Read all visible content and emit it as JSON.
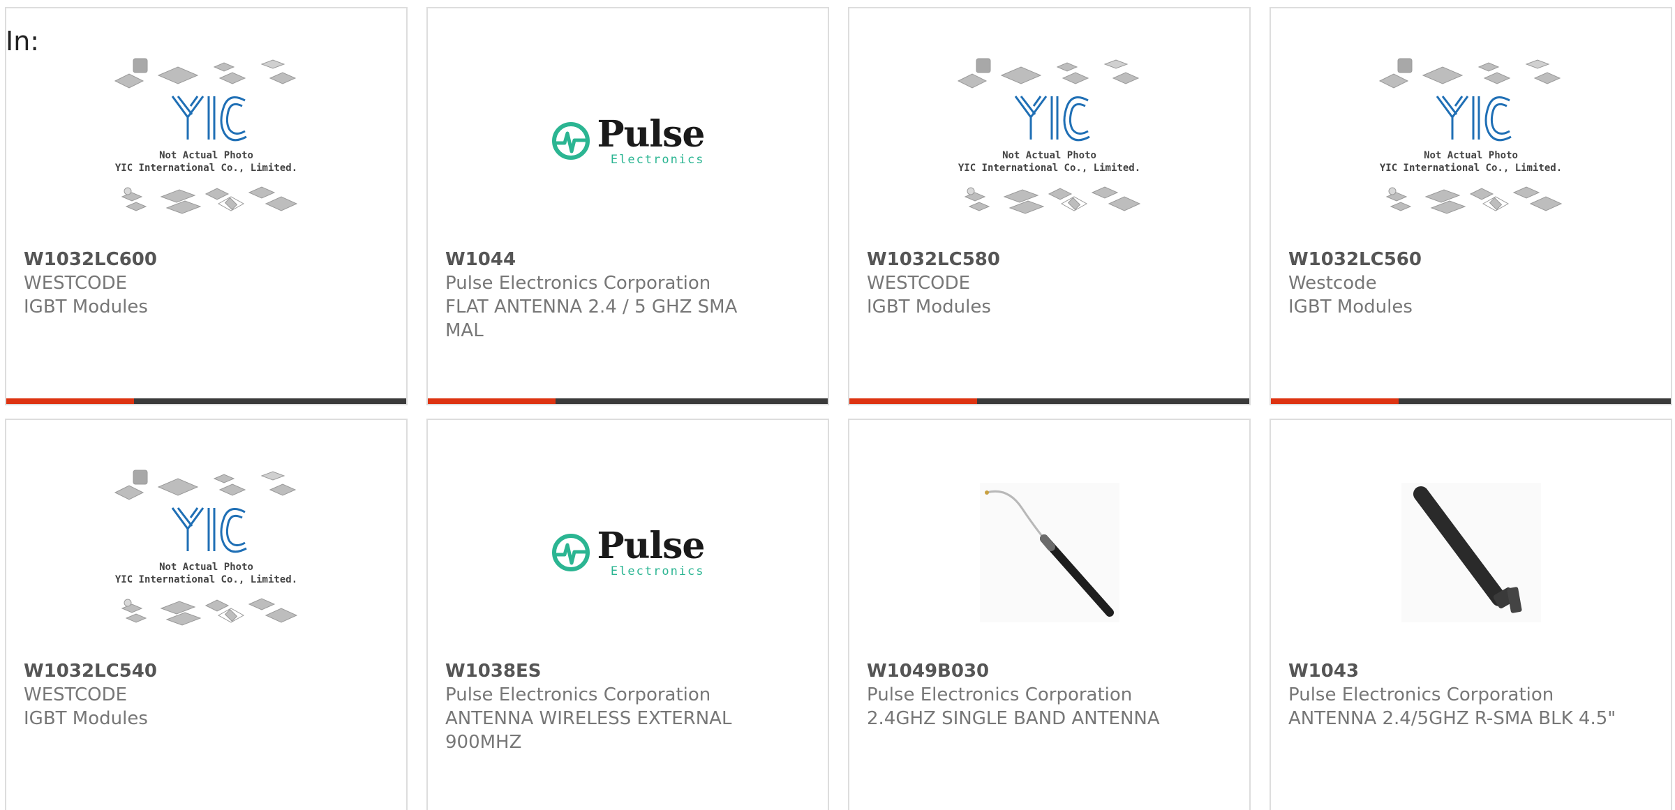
{
  "filter_label": "In:",
  "placeholder": {
    "line1": "Not Actual Photo",
    "line2": "YIC International Co., Limited."
  },
  "pulse_logo": {
    "brand": "Pulse",
    "sub": "Electronics"
  },
  "colors": {
    "accent_bar": "#dd3311",
    "bar_dark": "#3a3a3a",
    "pulse_teal": "#2bb592",
    "yic_blue": "#1f6fb5"
  },
  "products": [
    {
      "part": "W1032LC600",
      "manufacturer": "WESTCODE",
      "description": "IGBT Modules",
      "image": "yic-placeholder-image"
    },
    {
      "part": "W1044",
      "manufacturer": "Pulse Electronics Corporation",
      "description": "FLAT ANTENNA 2.4 / 5 GHZ SMA MAL",
      "image": "pulse-logo-image"
    },
    {
      "part": "W1032LC580",
      "manufacturer": "WESTCODE",
      "description": "IGBT Modules",
      "image": "yic-placeholder-image"
    },
    {
      "part": "W1032LC560",
      "manufacturer": "Westcode",
      "description": "IGBT Modules",
      "image": "yic-placeholder-image"
    },
    {
      "part": "W1032LC540",
      "manufacturer": "WESTCODE",
      "description": "IGBT Modules",
      "image": "yic-placeholder-image"
    },
    {
      "part": "W1038ES",
      "manufacturer": "Pulse Electronics Corporation",
      "description": "ANTENNA WIRELESS EXTERNAL 900MHZ",
      "image": "pulse-logo-image"
    },
    {
      "part": "W1049B030",
      "manufacturer": "Pulse Electronics Corporation",
      "description": "2.4GHZ SINGLE BAND ANTENNA",
      "image": "wire-antenna-photo"
    },
    {
      "part": "W1043",
      "manufacturer": "Pulse Electronics Corporation",
      "description": "ANTENNA 2.4/5GHZ R-SMA BLK 4.5\"",
      "image": "swivel-antenna-photo"
    }
  ]
}
